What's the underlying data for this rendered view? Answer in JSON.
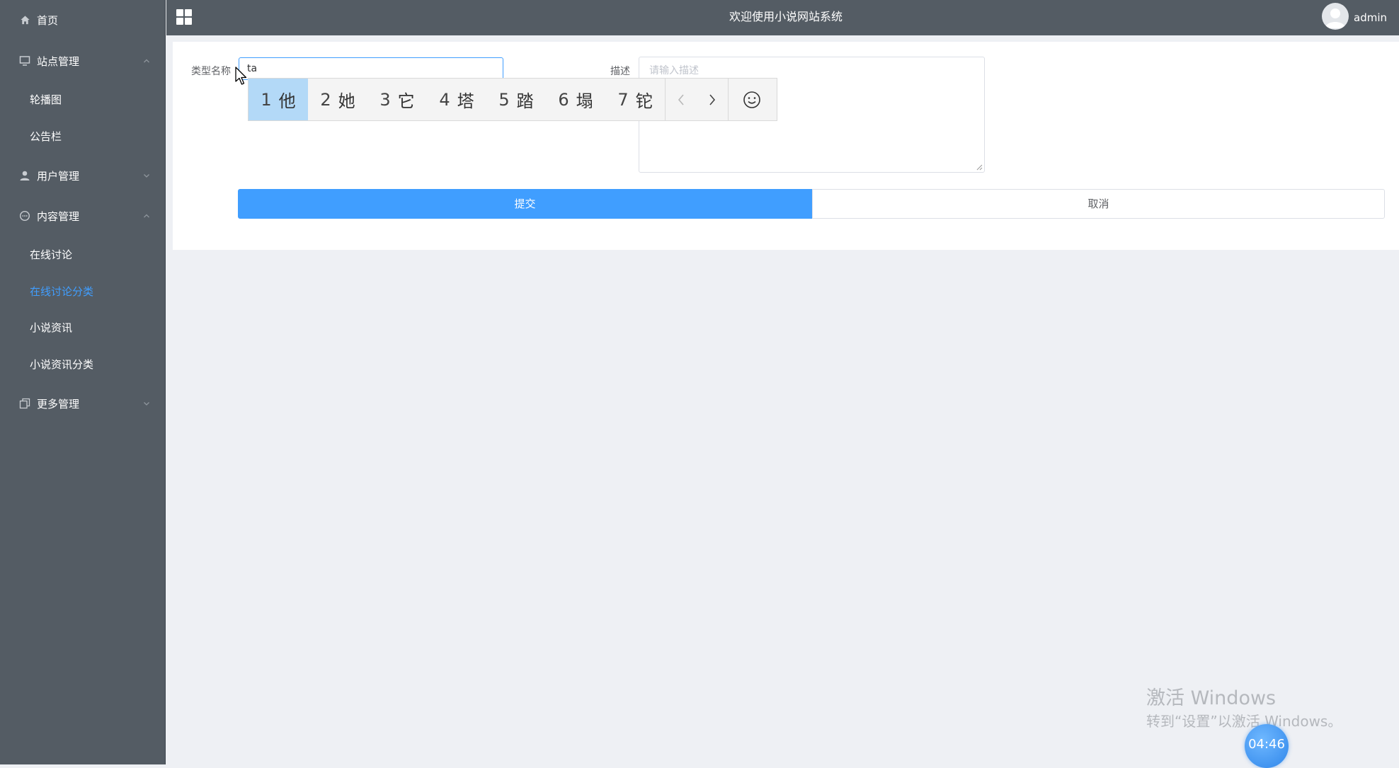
{
  "sidebar": {
    "home": "首页",
    "site_mgmt": "站点管理",
    "carousel": "轮播图",
    "notice": "公告栏",
    "user_mgmt": "用户管理",
    "content_mgmt": "内容管理",
    "forum": "在线讨论",
    "forum_category": "在线讨论分类",
    "news": "小说资讯",
    "news_category": "小说资讯分类",
    "more_mgmt": "更多管理"
  },
  "topbar": {
    "title": "欢迎使用小说网站系统",
    "username": "admin"
  },
  "form": {
    "name_label": "类型名称",
    "name_value": "ta",
    "desc_label": "描述",
    "desc_placeholder": "请输入描述",
    "submit": "提交",
    "cancel": "取消"
  },
  "ime": {
    "candidates": [
      {
        "num": "1",
        "char": "他"
      },
      {
        "num": "2",
        "char": "她"
      },
      {
        "num": "3",
        "char": "它"
      },
      {
        "num": "4",
        "char": "塔"
      },
      {
        "num": "5",
        "char": "踏"
      },
      {
        "num": "6",
        "char": "塌"
      },
      {
        "num": "7",
        "char": "铊"
      }
    ]
  },
  "overlay": {
    "watermark_title": "激活 Windows",
    "watermark_sub": "转到“设置”以激活 Windows。",
    "timer": "04:46"
  },
  "colors": {
    "sidebar_bg": "#545c64",
    "accent": "#409eff",
    "content_bg": "#eef0f4"
  }
}
